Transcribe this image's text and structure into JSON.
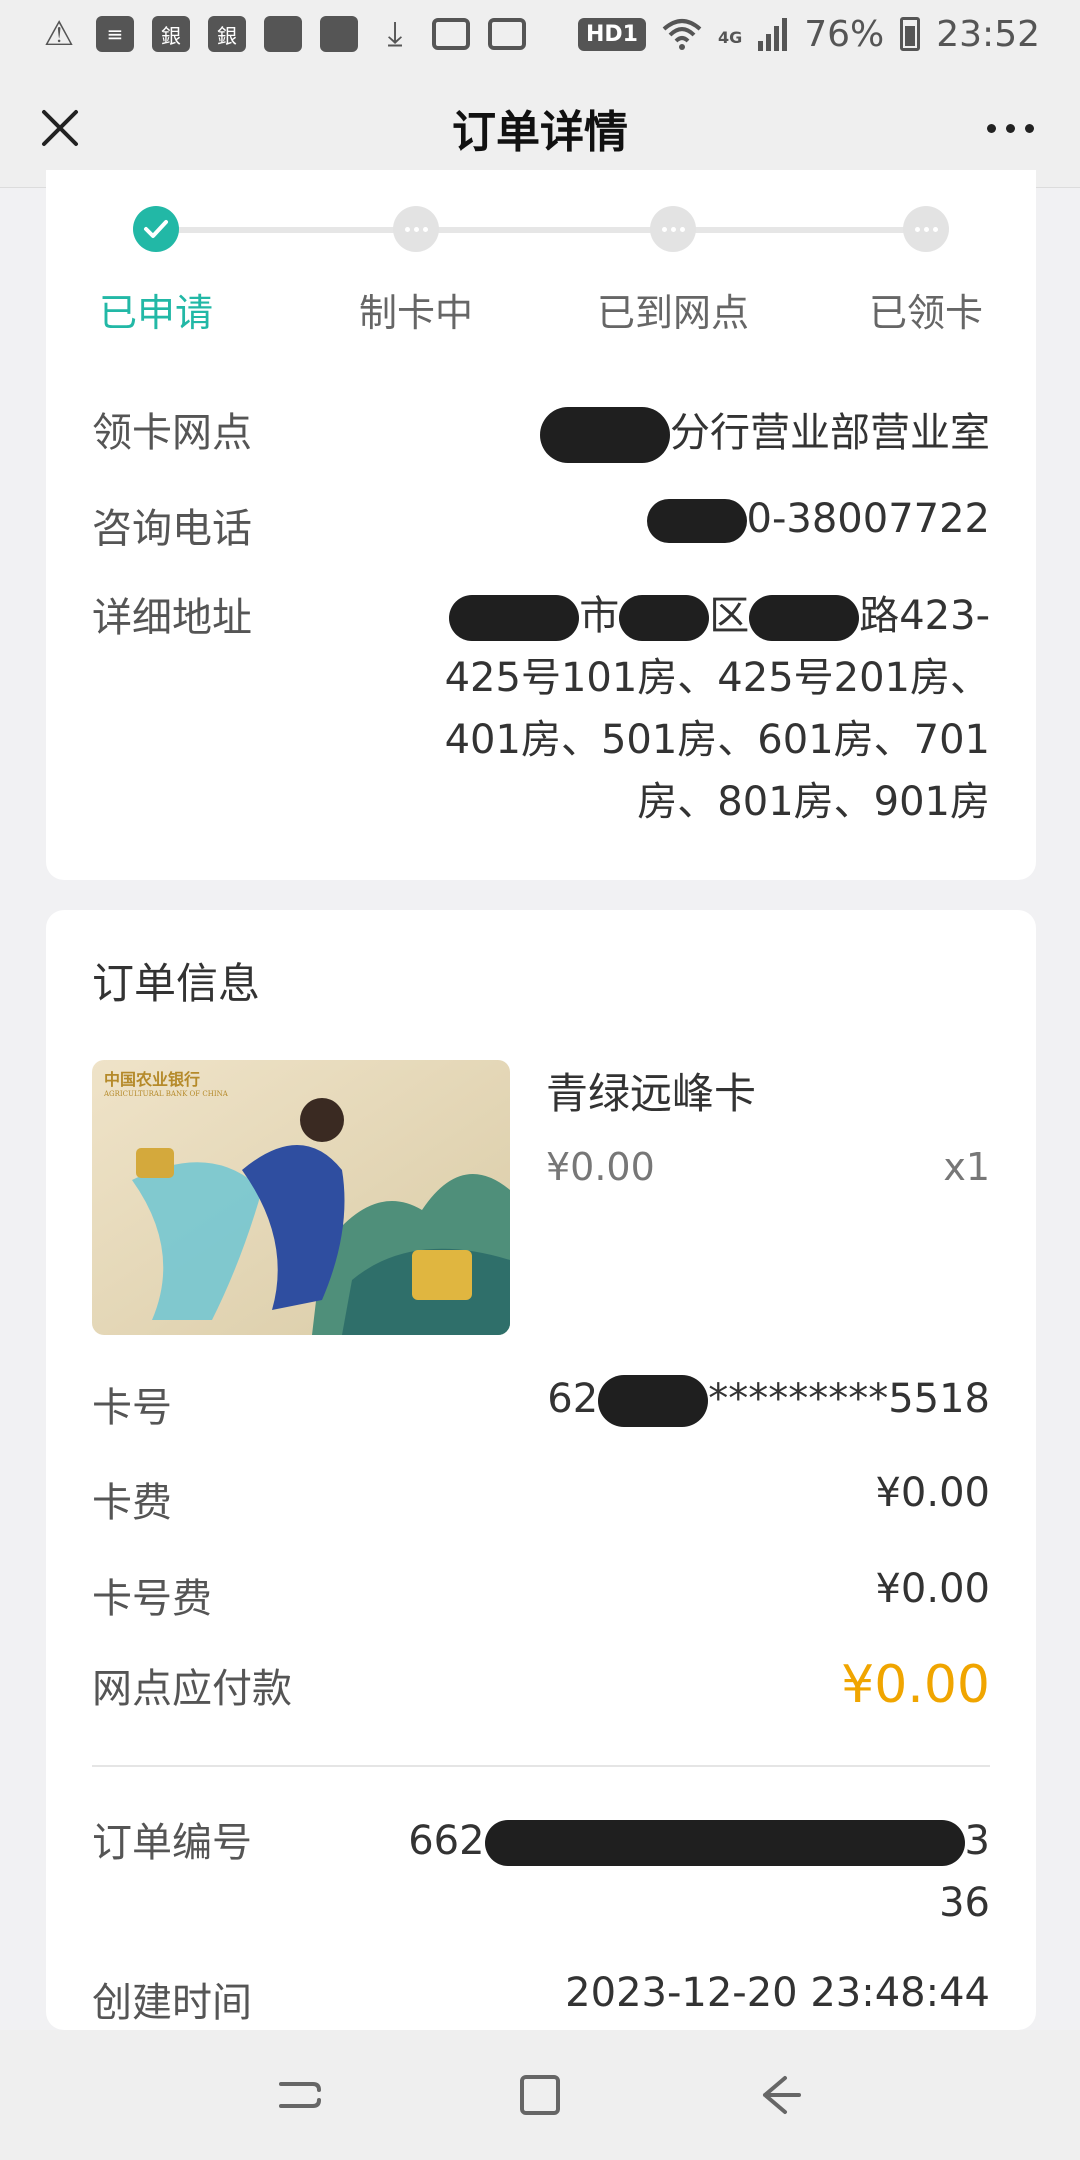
{
  "status_bar": {
    "battery": "76%",
    "time": "23:52",
    "hd_label": "HD1",
    "network_label": "4G",
    "icons": [
      "warning-icon",
      "document-icon",
      "bank-icon",
      "bank-icon",
      "app-icon",
      "app-icon",
      "download-icon",
      "image-icon",
      "voicemail-icon"
    ]
  },
  "header": {
    "title": "订单详情"
  },
  "progress": {
    "steps": [
      {
        "label": "已申请",
        "done": true
      },
      {
        "label": "制卡中",
        "done": false
      },
      {
        "label": "已到网点",
        "done": false
      },
      {
        "label": "已领卡",
        "done": false
      }
    ]
  },
  "branch_info": {
    "branch_label": "领卡网点",
    "branch_value": "分行营业部营业室",
    "phone_label": "咨询电话",
    "phone_value": "0-38007722",
    "address_label": "详细地址",
    "address_line1_a": "市",
    "address_line1_b": "区",
    "address_line1_c": "路423-",
    "address_rest": "425号101房、425号201房、401房、501房、601房、701房、801房、901房"
  },
  "order_info": {
    "section_title": "订单信息",
    "product_name": "青绿远峰卡",
    "product_price": "¥0.00",
    "product_qty": "x1",
    "card_image_bank_name": "中国农业银行",
    "card_image_bank_name_en": "AGRICULTURAL BANK OF CHINA",
    "card_no_label": "卡号",
    "card_no_prefix": "62",
    "card_no_suffix": "*********5518",
    "card_fee_label": "卡费",
    "card_fee_value": "¥0.00",
    "card_no_fee_label": "卡号费",
    "card_no_fee_value": "¥0.00",
    "pay_label": "网点应付款",
    "pay_value": "¥0.00",
    "order_no_label": "订单编号",
    "order_no_prefix": "662",
    "order_no_end1": "3",
    "order_no_end2": "36",
    "created_label": "创建时间",
    "created_value": "2023-12-20 23:48:44"
  },
  "colors": {
    "accent": "#22b8a6",
    "pay": "#f0a500"
  }
}
